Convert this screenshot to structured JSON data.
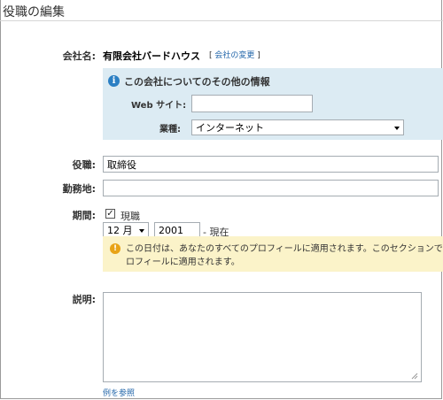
{
  "page": {
    "title": "役職の編集"
  },
  "company": {
    "label": "会社名:",
    "name": "有限会社バードハウス",
    "bracket_open": "[",
    "change_link": "会社の変更",
    "bracket_close": "]"
  },
  "info_box": {
    "icon": "info-icon",
    "title": "この会社についてのその他の情報",
    "website_label": "Web サイト:",
    "website_value": "",
    "industry_label": "業種:",
    "industry_value": "インターネット"
  },
  "position": {
    "label": "役職:",
    "value": "取締役"
  },
  "location": {
    "label": "勤務地:",
    "value": ""
  },
  "period": {
    "label": "期間:",
    "current_checked": true,
    "current_label": "現職",
    "month_value": "12 月",
    "year_value": "2001",
    "to_text": "- 現在"
  },
  "notice": {
    "icon": "warning-icon",
    "line1": "この日付は、あなたのすべてのプロフィールに適用されます。このセクションで",
    "line2": "ロフィールに適用されます。"
  },
  "description": {
    "label": "説明:",
    "value": "",
    "example_link": "例を参照"
  },
  "colors": {
    "info_bg": "#dcebf3",
    "notice_bg": "#fbf3c9",
    "link": "#2266aa",
    "info_icon": "#2b7fc3",
    "warning_icon": "#e8a317"
  }
}
